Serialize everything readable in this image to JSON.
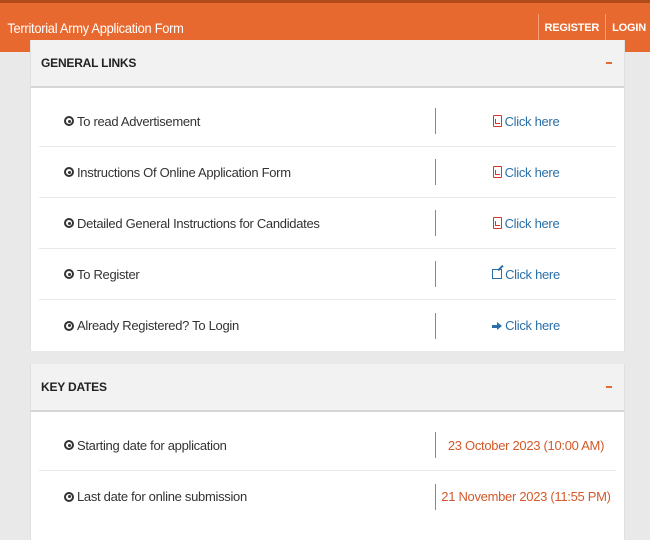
{
  "header": {
    "title": "Territorial Army Application Form",
    "register_label": "REGISTER",
    "login_label": "LOGIN"
  },
  "general_links": {
    "title": "GENERAL LINKS",
    "rows": [
      {
        "label": "To read Advertisement",
        "action": "Click here",
        "icon": "pdf-icon"
      },
      {
        "label": "Instructions Of Online Application Form",
        "action": "Click here",
        "icon": "pdf-icon"
      },
      {
        "label": "Detailed General Instructions for Candidates",
        "action": "Click here",
        "icon": "pdf-icon"
      },
      {
        "label": "To Register",
        "action": "Click here",
        "icon": "edit-icon"
      },
      {
        "label": "Already Registered? To Login",
        "action": "Click here",
        "icon": "sign-in-icon"
      }
    ]
  },
  "key_dates": {
    "title": "KEY DATES",
    "rows": [
      {
        "label": "Starting date for application",
        "value": "23 October 2023 (10:00 AM)"
      },
      {
        "label": "Last date for online submission",
        "value": "21 November 2023 (11:55 PM)"
      }
    ]
  },
  "colors": {
    "accent": "#e8692f",
    "link": "#2a6fa8",
    "pdf": "#d9342b",
    "date": "#d25a2a"
  }
}
